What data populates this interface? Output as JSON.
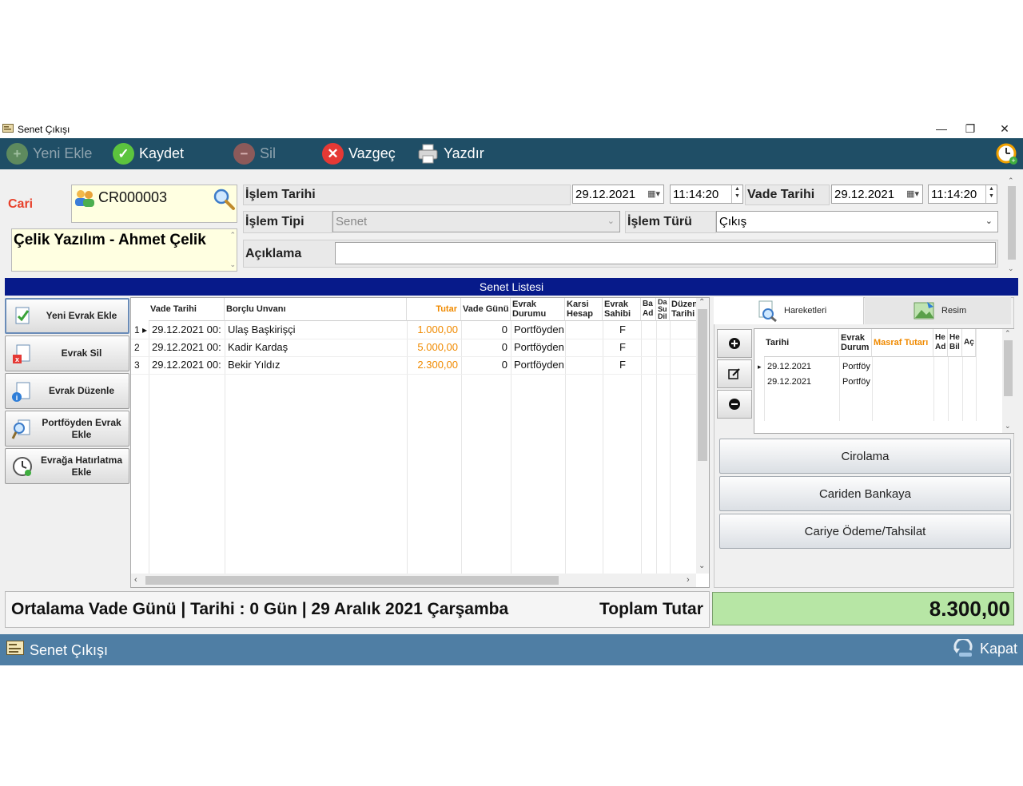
{
  "window": {
    "title": "Senet Çıkışı",
    "minimize": "—",
    "restore": "❐",
    "close": "✕"
  },
  "toolbar": {
    "new": "Yeni Ekle",
    "save": "Kaydet",
    "delete": "Sil",
    "cancel": "Vazgeç",
    "print": "Yazdır",
    "colors": {
      "bg": "#1f4e66",
      "save": "#5cc43e",
      "cancel": "#e53935"
    }
  },
  "form": {
    "cari_label": "Cari",
    "cari_code": "CR000003",
    "cari_name": "Çelik Yazılım - Ahmet Çelik",
    "islem_tarihi_label": "İşlem Tarihi",
    "islem_tarihi": "29.12.2021",
    "islem_saat": "11:14:20",
    "vade_tarihi_label": "Vade Tarihi",
    "vade_tarihi": "29.12.2021",
    "vade_saat": "11:14:20",
    "islem_tipi_label": "İşlem Tipi",
    "islem_tipi": "Senet",
    "islem_turu_label": "İşlem Türü",
    "islem_turu": "Çıkış",
    "aciklama_label": "Açıklama",
    "aciklama": ""
  },
  "list_title": "Senet Listesi",
  "side_buttons": [
    "Yeni Evrak Ekle",
    "Evrak Sil",
    "Evrak Düzenle",
    "Portföyden Evrak Ekle",
    "Evrağa Hatırlatma Ekle"
  ],
  "grid": {
    "columns": [
      "Vade Tarihi",
      "Borçlu Unvanı",
      "Tutar",
      "Vade Günü",
      "Evrak Durumu",
      "Karsi Hesap",
      "Evrak Sahibi",
      "Ba Ad",
      "Da Su Dil",
      "Düzen Tarihi"
    ],
    "rows": [
      {
        "no": "1",
        "vade": "29.12.2021 00:",
        "borclu": "Ulaş Başkirişçi",
        "tutar": "1.000,00",
        "gun": "0",
        "durum": "Portföyden",
        "sahip": "F"
      },
      {
        "no": "2",
        "vade": "29.12.2021 00:",
        "borclu": "Kadir Kardaş",
        "tutar": "5.000,00",
        "gun": "0",
        "durum": "Portföyden",
        "sahip": "F"
      },
      {
        "no": "3",
        "vade": "29.12.2021 00:",
        "borclu": "Bekir Yıldız",
        "tutar": "2.300,00",
        "gun": "0",
        "durum": "Portföyden",
        "sahip": "F"
      }
    ],
    "accent": "#f08a00"
  },
  "right": {
    "tab_movements": "Hareketleri",
    "tab_image": "Resim",
    "columns": [
      "Tarihi",
      "Evrak Durum",
      "Masraf Tutarı",
      "He Ad",
      "He Bil",
      "Aç"
    ],
    "rows": [
      {
        "tarih": "29.12.2021",
        "durum": "Portföy"
      },
      {
        "tarih": "29.12.2021",
        "durum": "Portföy"
      }
    ],
    "buttons": [
      "Cirolama",
      "Cariden Bankaya",
      "Cariye Ödeme/Tahsilat"
    ]
  },
  "summary": {
    "avg_text": "Ortalama Vade Günü | Tarihi : 0 Gün | 29 Aralık 2021 Çarşamba",
    "total_label": "Toplam Tutar",
    "total_value": "8.300,00"
  },
  "statusbar": {
    "title": "Senet Çıkışı",
    "close": "Kapat"
  }
}
